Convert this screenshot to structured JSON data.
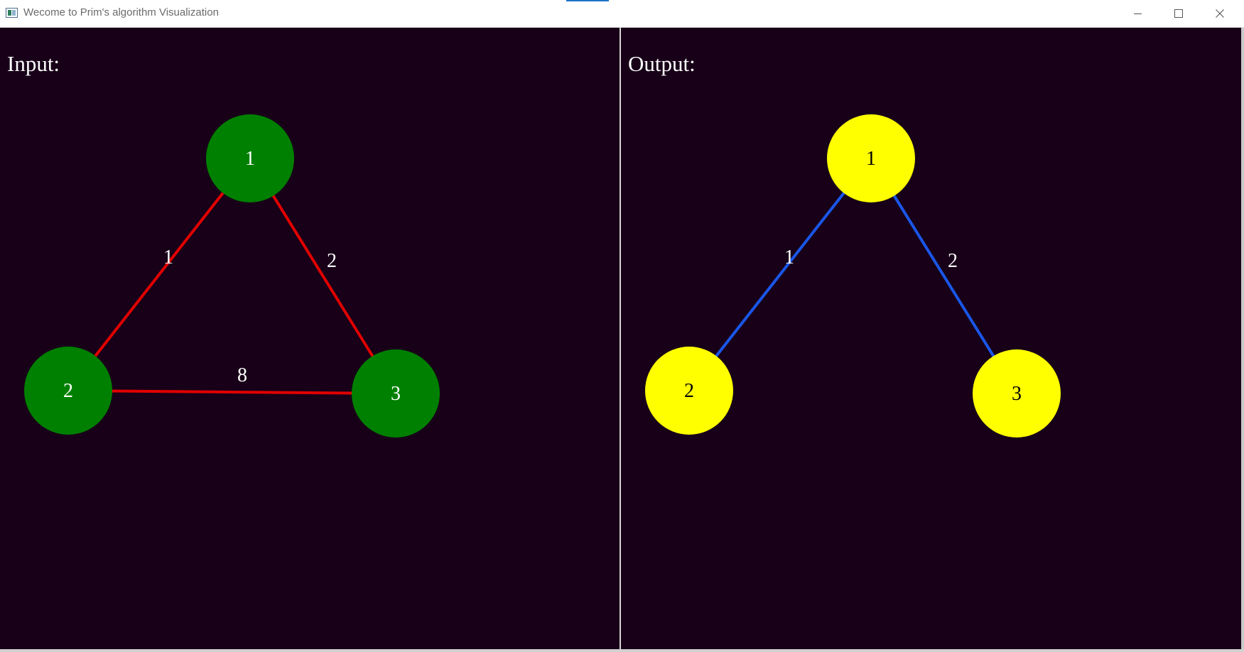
{
  "window": {
    "title": "Wecome to Prim's algorithm Visualization",
    "controls": [
      "minimize-icon",
      "maximize-icon",
      "close-icon"
    ]
  },
  "input_panel": {
    "label": "Input:",
    "node_color": "#008000",
    "node_text_color": "#ffffff",
    "edge_color": "#e00000",
    "nodes": [
      {
        "id": "1",
        "label": "1"
      },
      {
        "id": "2",
        "label": "2"
      },
      {
        "id": "3",
        "label": "3"
      }
    ],
    "edges": [
      {
        "from": "1",
        "to": "2",
        "weight": "1"
      },
      {
        "from": "1",
        "to": "3",
        "weight": "2"
      },
      {
        "from": "2",
        "to": "3",
        "weight": "8"
      }
    ]
  },
  "output_panel": {
    "label": "Output:",
    "node_color": "#ffff00",
    "node_text_color": "#000000",
    "edge_color": "#1a56e8",
    "nodes": [
      {
        "id": "1",
        "label": "1"
      },
      {
        "id": "2",
        "label": "2"
      },
      {
        "id": "3",
        "label": "3"
      }
    ],
    "edges": [
      {
        "from": "1",
        "to": "2",
        "weight": "1"
      },
      {
        "from": "1",
        "to": "3",
        "weight": "2"
      }
    ]
  },
  "colors": {
    "canvas_background": "#170018",
    "label_text": "#ffffff"
  }
}
